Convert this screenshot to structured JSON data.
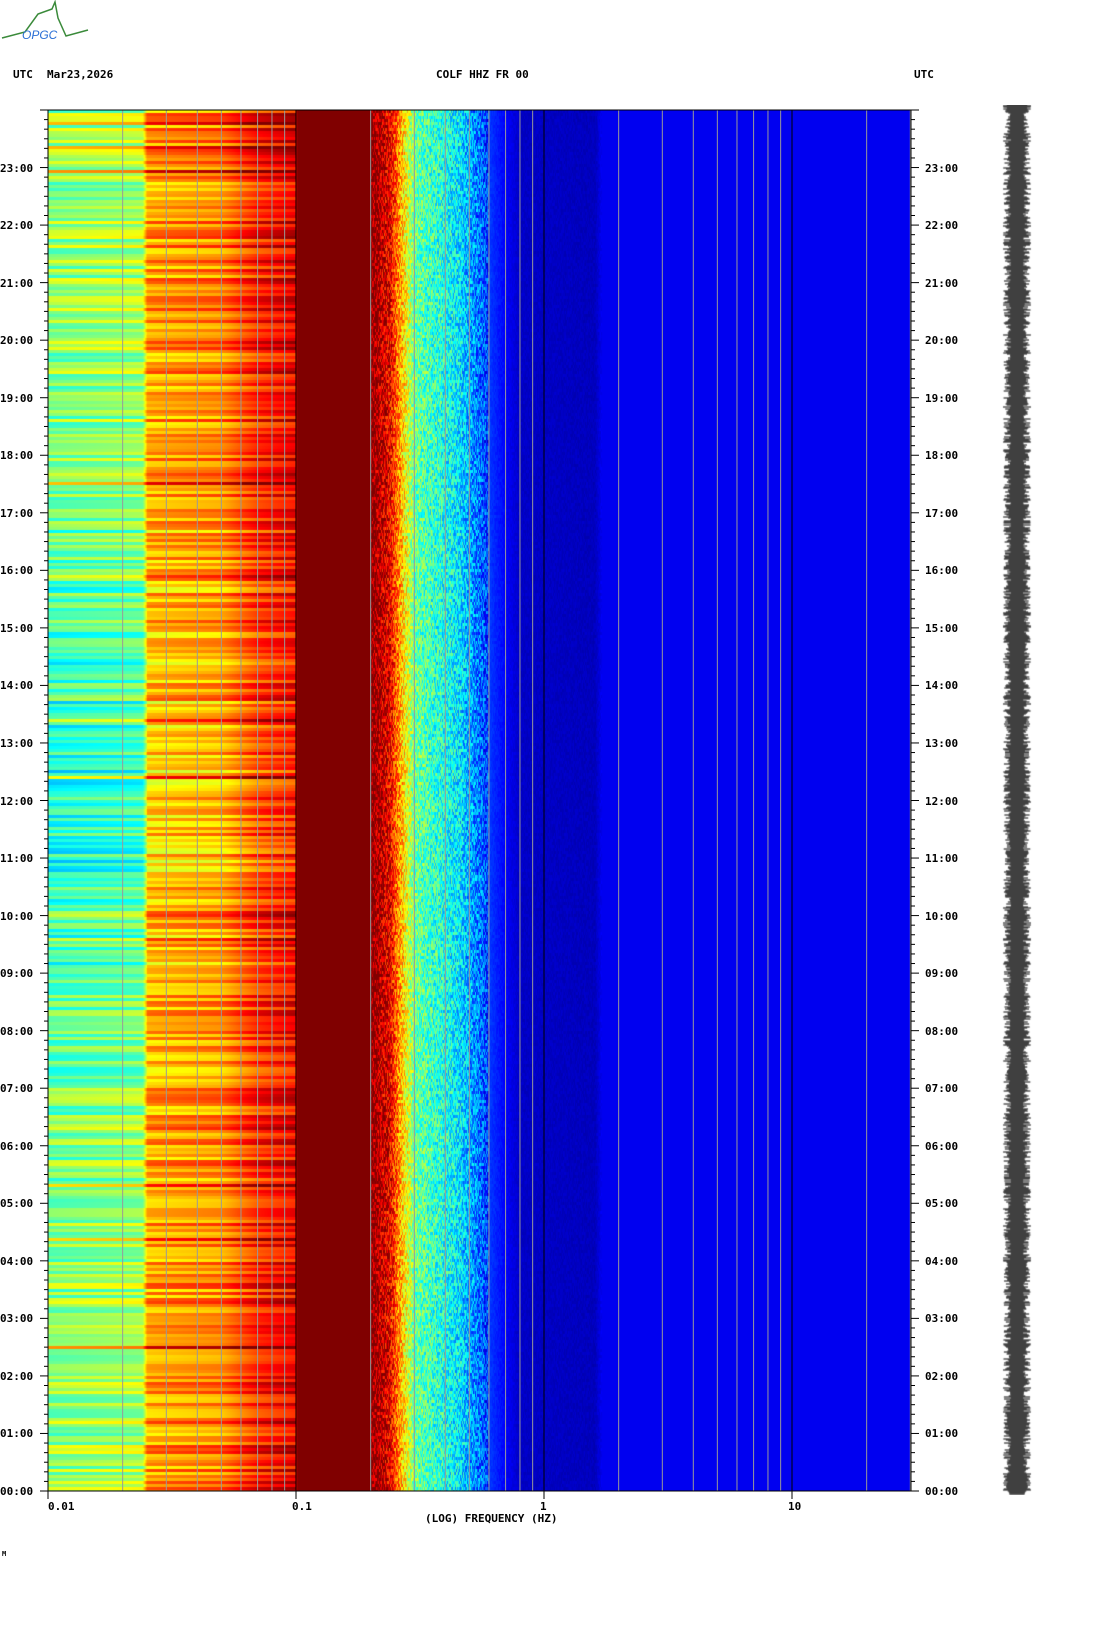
{
  "header": {
    "timezone_left": "UTC",
    "date": "Mar23,2026",
    "station": "COLF HHZ FR 00",
    "timezone_right": "UTC"
  },
  "logo_text": "OPGC",
  "footer_mark": "M",
  "chart_data": {
    "type": "heatmap",
    "title": "COLF HHZ FR 00",
    "xlabel": "(LOG) FREQUENCY (HZ)",
    "xscale": "log",
    "xlim": [
      0.01,
      30
    ],
    "xticks": [
      {
        "value": 0.01,
        "label": "0.01"
      },
      {
        "value": 0.1,
        "label": "0.1"
      },
      {
        "value": 1,
        "label": "1"
      },
      {
        "value": 10,
        "label": "10"
      }
    ],
    "ylabel": "UTC",
    "ylim_hours": [
      0,
      24
    ],
    "yticks": [
      "00:00",
      "01:00",
      "02:00",
      "03:00",
      "04:00",
      "05:00",
      "06:00",
      "07:00",
      "08:00",
      "09:00",
      "10:00",
      "11:00",
      "12:00",
      "13:00",
      "14:00",
      "15:00",
      "16:00",
      "17:00",
      "18:00",
      "19:00",
      "20:00",
      "21:00",
      "22:00",
      "23:00"
    ],
    "colormap": "jet",
    "grid": true,
    "relative_power_profile": [
      {
        "freq": 0.01,
        "level": 0.52
      },
      {
        "freq": 0.024,
        "level": 0.55
      },
      {
        "freq": 0.025,
        "level": 0.72
      },
      {
        "freq": 0.05,
        "level": 0.75
      },
      {
        "freq": 0.07,
        "level": 0.85
      },
      {
        "freq": 0.1,
        "level": 0.9
      },
      {
        "freq": 0.101,
        "level": 1.0
      },
      {
        "freq": 0.2,
        "level": 1.0
      },
      {
        "freq": 0.24,
        "level": 0.88
      },
      {
        "freq": 0.27,
        "level": 0.66
      },
      {
        "freq": 0.3,
        "level": 0.48
      },
      {
        "freq": 0.45,
        "level": 0.36
      },
      {
        "freq": 0.6,
        "level": 0.18
      },
      {
        "freq": 0.8,
        "level": 0.07
      },
      {
        "freq": 1.6,
        "level": 0.06
      },
      {
        "freq": 1.7,
        "level": 0.11
      },
      {
        "freq": 30,
        "level": 0.11
      }
    ]
  }
}
